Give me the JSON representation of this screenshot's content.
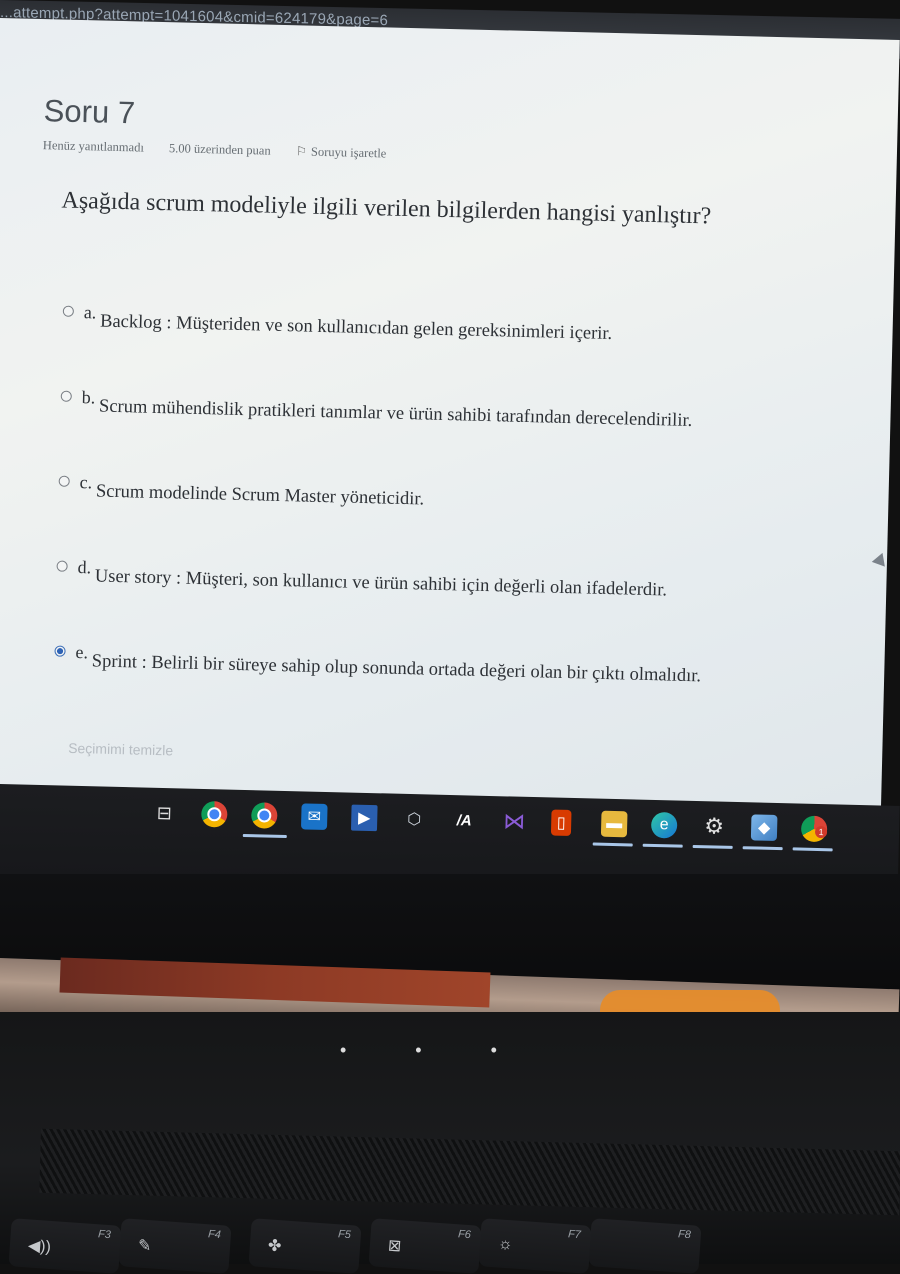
{
  "browser": {
    "url_fragment": "...attempt.php?attempt=1041604&cmid=624179&page=6"
  },
  "quiz": {
    "question_title": "Soru 7",
    "status": "Henüz yanıtlanmadı",
    "points": "5.00 üzerinden puan",
    "flag_label": "Soruyu işaretle",
    "question_text": "Aşağıda scrum modeliyle ilgili verilen bilgilerden hangisi yanlıştır?",
    "options": [
      {
        "letter": "a.",
        "text": "Backlog : Müşteriden ve son kullanıcıdan gelen gereksinimleri içerir.",
        "selected": false
      },
      {
        "letter": "b.",
        "text": "Scrum mühendislik pratikleri tanımlar ve ürün sahibi tarafından derecelendirilir.",
        "selected": false
      },
      {
        "letter": "c.",
        "text": "Scrum modelinde Scrum Master yöneticidir.",
        "selected": false
      },
      {
        "letter": "d.",
        "text": "User story : Müşteri, son kullanıcı ve ürün sahibi için değerli olan ifadelerdir.",
        "selected": false
      },
      {
        "letter": "e.",
        "text": "Sprint :  Belirli bir süreye sahip olup sonunda ortada değeri olan bir çıktı olmalıdır.",
        "selected": true
      }
    ],
    "clear_choice": "Seçimimi temizle"
  },
  "taskbar": {
    "icons": [
      "task-view-icon",
      "chrome-icon",
      "chrome-alt-icon",
      "mail-icon",
      "teams-icon",
      "cube-icon",
      "app-ia-icon",
      "visual-studio-icon",
      "office-icon",
      "file-explorer-icon",
      "edge-icon",
      "settings-icon",
      "store-icon",
      "chrome-notify-icon"
    ],
    "badge_count": "1"
  },
  "keyboard": {
    "fkeys": [
      "F3",
      "F4",
      "F5",
      "F6",
      "F7",
      "F8"
    ]
  },
  "colors": {
    "accent_radio": "#2d62b5",
    "page_bg": "#eef1f2",
    "taskbar_bg": "#1c1d20"
  }
}
